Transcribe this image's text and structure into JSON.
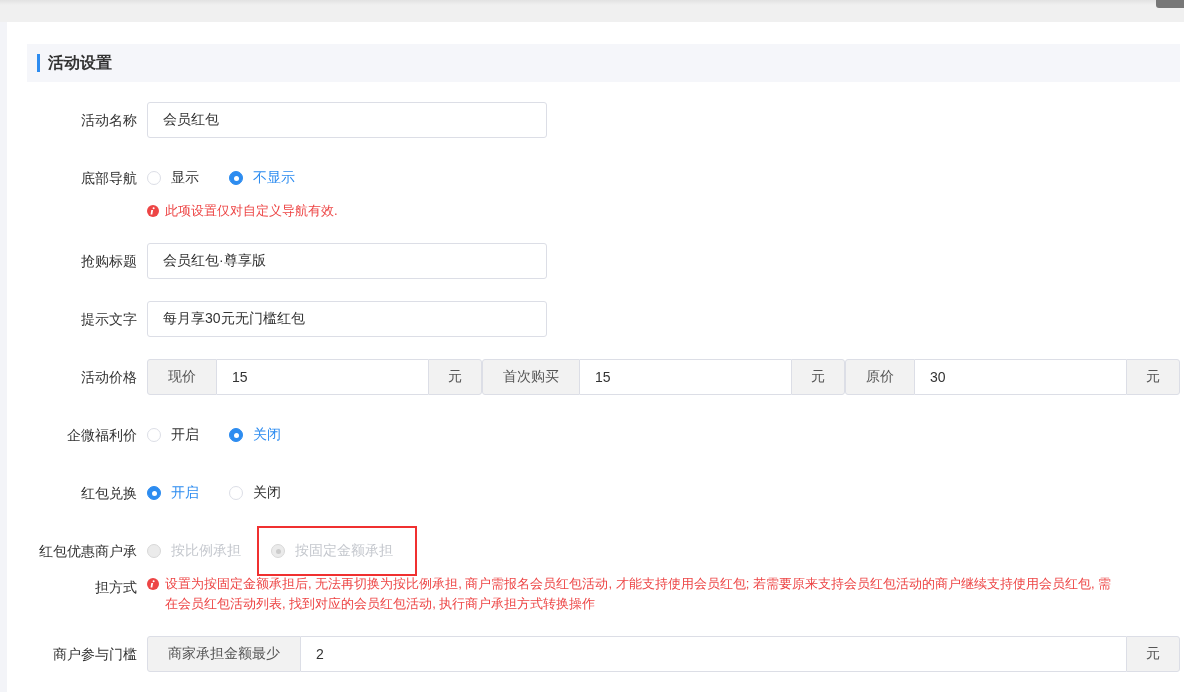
{
  "section": {
    "title": "活动设置"
  },
  "fields": [
    {
      "kind": "text",
      "label": "活动名称",
      "value": "会员红包"
    },
    {
      "kind": "radio",
      "label": "底部导航",
      "disabled": false,
      "options": [
        {
          "label": "显示",
          "selected": false,
          "highlighted": false
        },
        {
          "label": "不显示",
          "selected": true,
          "highlighted": false
        }
      ],
      "warning": "此项设置仅对自定义导航有效."
    },
    {
      "kind": "text",
      "label": "抢购标题",
      "value": "会员红包·尊享版"
    },
    {
      "kind": "text",
      "label": "提示文字",
      "value": "每月享30元无门槛红包"
    },
    {
      "kind": "price",
      "label": "活动价格",
      "groups": [
        {
          "addon": "现价",
          "value": "15",
          "unit": "元"
        },
        {
          "addon": "首次购买",
          "value": "15",
          "unit": "元"
        },
        {
          "addon": "原价",
          "value": "30",
          "unit": "元"
        }
      ]
    },
    {
      "kind": "radio",
      "label": "企微福利价",
      "disabled": false,
      "options": [
        {
          "label": "开启",
          "selected": false,
          "highlighted": false
        },
        {
          "label": "关闭",
          "selected": true,
          "highlighted": false
        }
      ]
    },
    {
      "kind": "radio",
      "label": "红包兑换",
      "disabled": false,
      "options": [
        {
          "label": "开启",
          "selected": true,
          "highlighted": false
        },
        {
          "label": "关闭",
          "selected": false,
          "highlighted": false
        }
      ]
    },
    {
      "kind": "radio",
      "label": "红包优惠商户承担方式",
      "disabled": true,
      "options": [
        {
          "label": "按比例承担",
          "selected": false,
          "highlighted": false
        },
        {
          "label": "按固定金额承担",
          "selected": true,
          "highlighted": true
        }
      ],
      "warning": "设置为按固定金额承担后, 无法再切换为按比例承担, 商户需报名会员红包活动, 才能支持使用会员红包; 若需要原来支持会员红包活动的商户继续支持使用会员红包, 需在会员红包活动列表, 找到对应的会员红包活动, 执行商户承担方式转换操作"
    },
    {
      "kind": "price",
      "label": "商户参与门槛",
      "groups": [
        {
          "addon": "商家承担金额最少",
          "value": "2",
          "unit": "元"
        }
      ]
    }
  ]
}
